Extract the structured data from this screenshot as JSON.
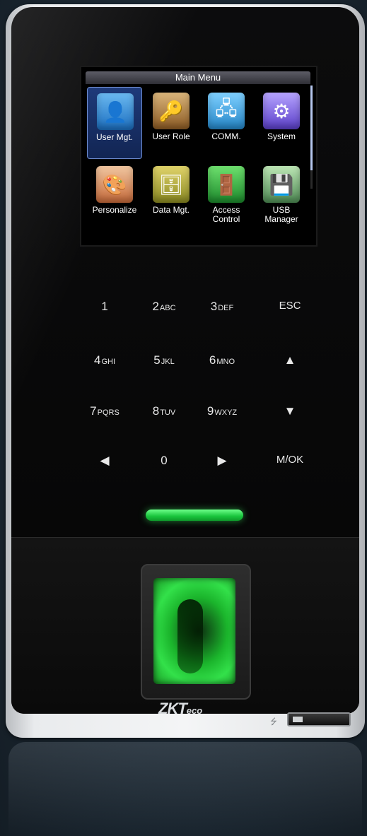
{
  "screen": {
    "title": "Main Menu",
    "menu_items": [
      {
        "label": "User Mgt.",
        "icon": "user-icon",
        "selected": true
      },
      {
        "label": "User Role",
        "icon": "key-icon",
        "selected": false
      },
      {
        "label": "COMM.",
        "icon": "network-icon",
        "selected": false
      },
      {
        "label": "System",
        "icon": "gear-icon",
        "selected": false
      },
      {
        "label": "Personalize",
        "icon": "palette-icon",
        "selected": false
      },
      {
        "label": "Data Mgt.",
        "icon": "database-icon",
        "selected": false
      },
      {
        "label_line1": "Access",
        "label_line2": "Control",
        "icon": "door-icon",
        "selected": false
      },
      {
        "label_line1": "USB",
        "label_line2": "Manager",
        "icon": "usb-drive-icon",
        "selected": false
      }
    ]
  },
  "keypad": {
    "k1": {
      "num": "1",
      "sub": ""
    },
    "k2": {
      "num": "2",
      "sub": "ABC"
    },
    "k3": {
      "num": "3",
      "sub": "DEF"
    },
    "esc": "ESC",
    "k4": {
      "num": "4",
      "sub": "GHI"
    },
    "k5": {
      "num": "5",
      "sub": "JKL"
    },
    "k6": {
      "num": "6",
      "sub": "MNO"
    },
    "up": "▲",
    "k7": {
      "num": "7",
      "sub": "PQRS"
    },
    "k8": {
      "num": "8",
      "sub": "TUV"
    },
    "k9": {
      "num": "9",
      "sub": "WXYZ"
    },
    "down": "▼",
    "left": "◀",
    "k0": {
      "num": "0",
      "sub": ""
    },
    "right": "▶",
    "ok": "M/OK"
  },
  "brand": {
    "main": "ZKT",
    "suffix": "eco"
  },
  "usb_symbol": "⭍",
  "colors": {
    "led": "#1fd141",
    "selection": "#1e3a7a"
  }
}
